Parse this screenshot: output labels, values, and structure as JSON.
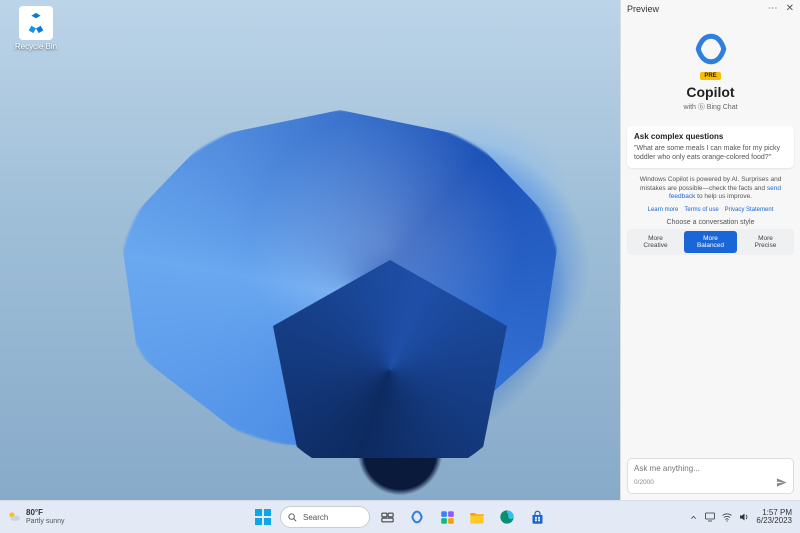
{
  "desktop": {
    "recycle_bin_label": "Recycle Bin"
  },
  "copilot": {
    "header_title": "Preview",
    "pre_badge": "PRE",
    "title": "Copilot",
    "subtitle": "with ⓑ Bing Chat",
    "card_title": "Ask complex questions",
    "card_example": "\"What are some meals I can make for my picky toddler who only eats orange-colored food?\"",
    "disclaimer_pre": "Windows Copilot is powered by AI. Surprises and mistakes are possible—check the facts and ",
    "disclaimer_link": "send feedback",
    "disclaimer_post": " to help us improve.",
    "links": [
      "Learn more",
      "Terms of use",
      "Privacy Statement"
    ],
    "style_label": "Choose a conversation style",
    "styles": [
      {
        "line1": "More",
        "line2": "Creative",
        "active": false
      },
      {
        "line1": "More",
        "line2": "Balanced",
        "active": true
      },
      {
        "line1": "More",
        "line2": "Precise",
        "active": false
      }
    ],
    "input_placeholder": "Ask me anything...",
    "char_count": "0/2000"
  },
  "taskbar": {
    "weather_temp": "80°F",
    "weather_desc": "Partly sunny",
    "search_placeholder": "Search",
    "time": "1:57 PM",
    "date": "6/23/2023"
  }
}
